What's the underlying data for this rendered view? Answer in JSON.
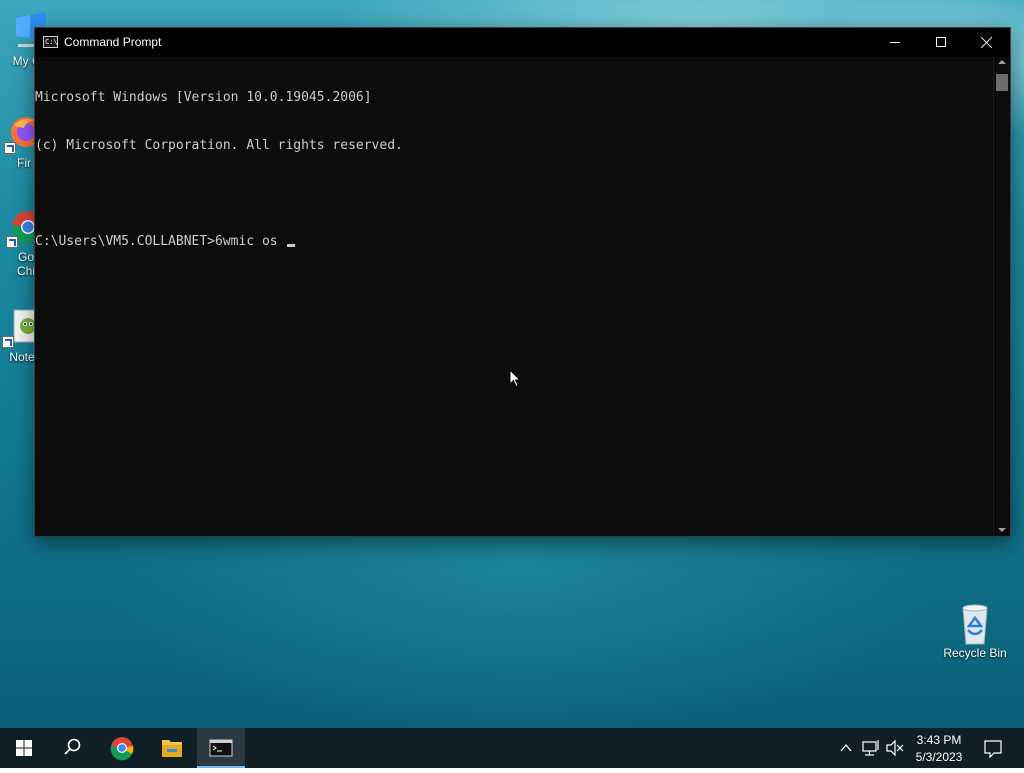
{
  "desktop": {
    "icons": [
      {
        "label": "My Co",
        "icon": "this-pc-icon"
      },
      {
        "label": "Fir",
        "icon": "firefox-icon"
      },
      {
        "label": "Go\nChi",
        "label_line1": "Go",
        "label_line2": "Chi",
        "icon": "chrome-icon"
      },
      {
        "label": "Note",
        "icon": "notepad-icon"
      },
      {
        "label": "Recycle Bin",
        "icon": "recycle-bin-icon"
      }
    ]
  },
  "window": {
    "title": "Command Prompt",
    "icon": "cmd-icon",
    "controls": {
      "minimize": "minimize-icon",
      "maximize": "maximize-icon",
      "close": "close-icon"
    }
  },
  "console": {
    "lines": [
      "Microsoft Windows [Version 10.0.19045.2006]",
      "(c) Microsoft Corporation. All rights reserved.",
      "",
      "C:\\Users\\VM5.COLLABNET>6wmic os "
    ]
  },
  "taskbar": {
    "apps": [
      {
        "name": "start",
        "icon": "windows-logo-icon"
      },
      {
        "name": "search",
        "icon": "search-icon"
      },
      {
        "name": "chrome",
        "icon": "chrome-icon"
      },
      {
        "name": "file-explorer",
        "icon": "folder-icon"
      },
      {
        "name": "command-prompt",
        "icon": "cmd-icon",
        "active": true
      }
    ],
    "tray": {
      "icons": [
        "chevron-up-icon",
        "network-icon",
        "volume-muted-icon"
      ],
      "time": "3:43 PM",
      "date": "5/3/2023",
      "notifications_icon": "action-center-icon"
    }
  },
  "colors": {
    "console_bg": "#0c0c0c",
    "console_fg": "#cccccc",
    "title_bar": "#000000",
    "taskbar": "#0f1f25",
    "accent": "#76b9ed"
  }
}
